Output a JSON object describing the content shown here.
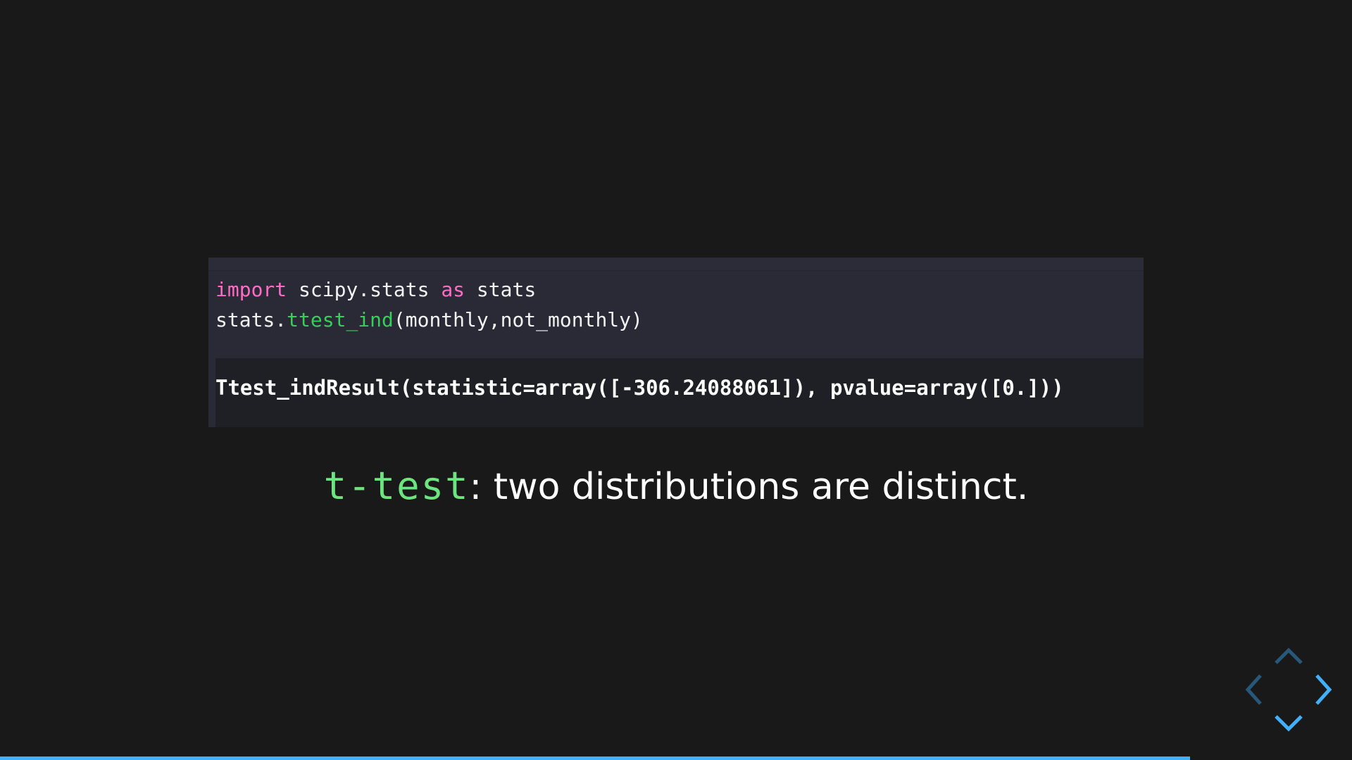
{
  "code": {
    "line1": {
      "kw1": "import",
      "mid": " scipy.stats ",
      "kw2": "as",
      "end": " stats"
    },
    "line2": {
      "prefix": "stats.",
      "fn": "ttest_ind",
      "args": "(monthly,not_monthly)"
    },
    "output": "Ttest_indResult(statistic=array([-306.24088061]), pvalue=array([0.]))"
  },
  "caption": {
    "code": "t-test",
    "text": ": two distributions are distinct."
  },
  "nav": {
    "up_icon": "chevron-up-icon",
    "left_icon": "chevron-left-icon",
    "right_icon": "chevron-right-icon",
    "down_icon": "chevron-down-icon",
    "enabled_color": "#42affa",
    "disabled_color": "#27587a"
  },
  "progress": {
    "fraction": 0.88,
    "color": "#42affa"
  }
}
